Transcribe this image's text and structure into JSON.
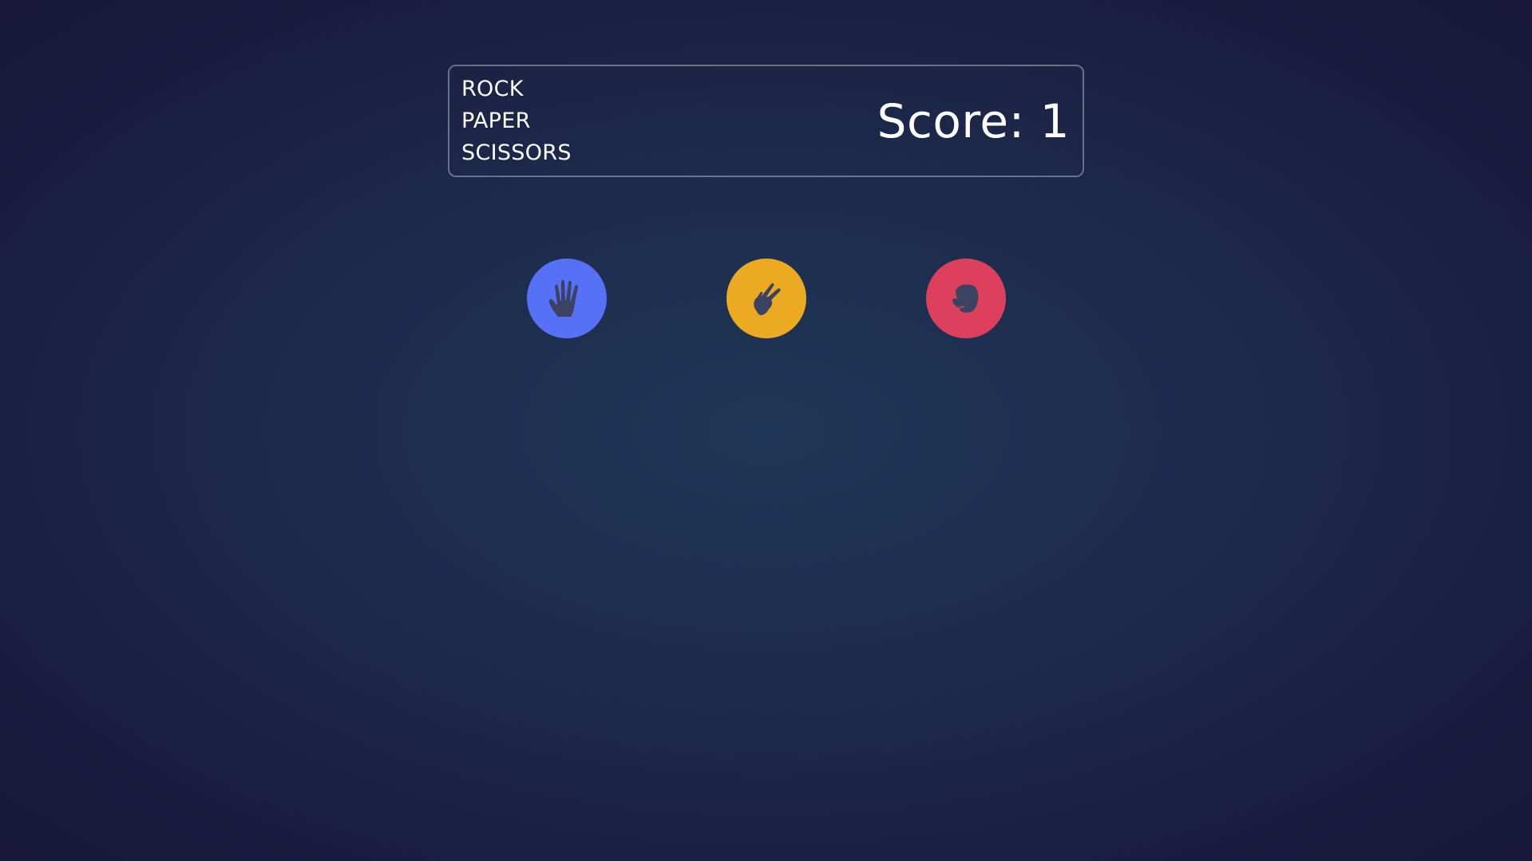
{
  "header": {
    "title_lines": [
      "ROCK",
      "PAPER",
      "SCISSORS"
    ],
    "score_text": "Score: 1"
  },
  "choices": [
    {
      "id": "paper",
      "icon": "hand-paper-icon",
      "color": "#5671f5"
    },
    {
      "id": "scissors",
      "icon": "hand-scissors-icon",
      "color": "#eca922"
    },
    {
      "id": "rock",
      "icon": "hand-rock-icon",
      "color": "#dd405d"
    }
  ],
  "colors": {
    "icon_fill": "#3b4363",
    "border": "rgba(255,255,255,0.35)"
  }
}
